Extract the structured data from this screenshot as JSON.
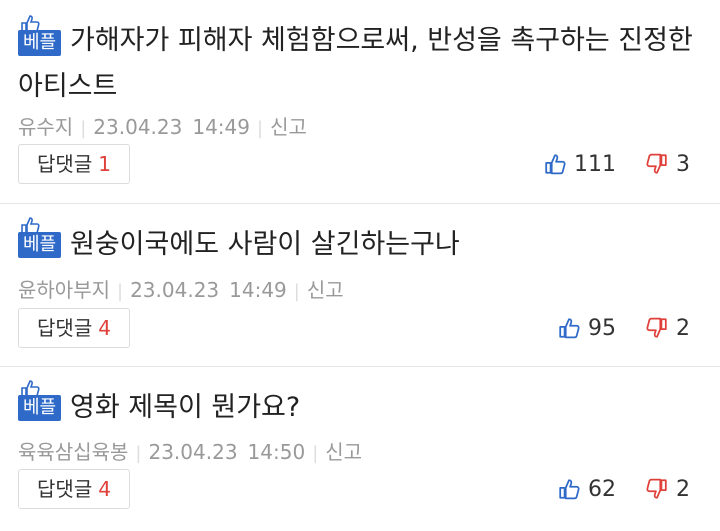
{
  "comments": [
    {
      "badge": "베플",
      "text": "가해자가 피해자 체험함으로써, 반성을 촉구하는 진정한 아티스트",
      "author": "유수지",
      "date": "23.04.23",
      "time": "14:49",
      "report_label": "신고",
      "reply_label": "답댓글",
      "reply_count": "1",
      "likes": "111",
      "dislikes": "3"
    },
    {
      "badge": "베플",
      "text": "원숭이국에도 사람이 살긴하는구나",
      "author": "윤하아부지",
      "date": "23.04.23",
      "time": "14:49",
      "report_label": "신고",
      "reply_label": "답댓글",
      "reply_count": "4",
      "likes": "95",
      "dislikes": "2"
    },
    {
      "badge": "베플",
      "text": "영화 제목이 뭔가요?",
      "author": "육육삼십육봉",
      "date": "23.04.23",
      "time": "14:50",
      "report_label": "신고",
      "reply_label": "답댓글",
      "reply_count": "4",
      "likes": "62",
      "dislikes": "2"
    }
  ],
  "colors": {
    "badge": "#2f6ac8",
    "like_icon": "#2f6ac8",
    "dislike_icon": "#e0403a",
    "reply_count": "#e0403a",
    "meta_text": "#999999"
  },
  "icons": {
    "best": "thumbs-up-icon",
    "like": "thumbs-up-outline-icon",
    "dislike": "thumbs-down-outline-icon"
  }
}
